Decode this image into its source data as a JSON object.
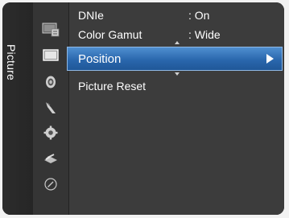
{
  "sidebar": {
    "title": "Picture"
  },
  "icons": [
    {
      "name": "picture-list-icon"
    },
    {
      "name": "picture-icon",
      "active": true
    },
    {
      "name": "sound-icon"
    },
    {
      "name": "channel-icon"
    },
    {
      "name": "setup-icon"
    },
    {
      "name": "input-icon"
    },
    {
      "name": "application-icon"
    }
  ],
  "menu": {
    "dnie": {
      "label": "DNIe",
      "value": ": On"
    },
    "color_gamut": {
      "label": "Color Gamut",
      "value": ": Wide"
    },
    "position": {
      "label": "Position"
    },
    "picture_reset": {
      "label": "Picture Reset"
    }
  },
  "colors": {
    "highlight": "#2a67ad",
    "background": "#3c3c3c"
  }
}
